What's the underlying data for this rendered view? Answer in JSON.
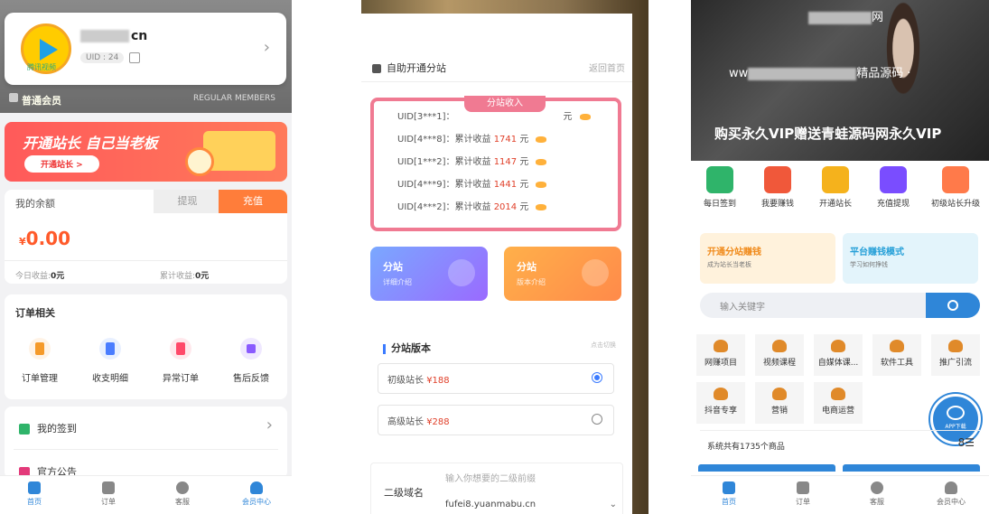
{
  "panel1": {
    "user": {
      "name_suffix": "cn",
      "uid": "UID : 24",
      "logo_text": "腾讯视频"
    },
    "member": {
      "level": "普通会员",
      "label_en": "REGULAR MEMBERS"
    },
    "banner": {
      "title": "开通站长 自己当老板",
      "button": "开通站长 >"
    },
    "balance": {
      "label": "我的余额",
      "tab_withdraw": "提现",
      "tab_recharge": "充值",
      "currency": "¥",
      "amount": "0.00",
      "today_label": "今日收益:",
      "today_value": "0元",
      "total_label": "累计收益:",
      "total_value": "0元"
    },
    "orders": {
      "title": "订单相关",
      "items": [
        "订单管理",
        "收支明细",
        "异常订单",
        "售后反馈"
      ]
    },
    "list": [
      "我的签到",
      "官方公告"
    ],
    "tabbar": [
      "首页",
      "订单",
      "客服",
      "会员中心"
    ]
  },
  "panel2": {
    "header": {
      "title": "自助开通分站",
      "back": "返回首页"
    },
    "income": {
      "title": "分站收入",
      "rows": [
        {
          "uid": "UID[3***1]：",
          "label": "",
          "value": "",
          "unit": "元"
        },
        {
          "uid": "UID[4***8]：",
          "label": "累计收益",
          "value": "1741",
          "unit": "元"
        },
        {
          "uid": "UID[1***2]：",
          "label": "累计收益",
          "value": "1147",
          "unit": "元"
        },
        {
          "uid": "UID[4***9]：",
          "label": "累计收益",
          "value": "1441",
          "unit": "元"
        },
        {
          "uid": "UID[4***2]：",
          "label": "累计收益",
          "value": "2014",
          "unit": "元"
        }
      ]
    },
    "cards": [
      {
        "title": "分站",
        "sub": "详细介绍",
        "color": "#8a7dff"
      },
      {
        "title": "分站",
        "sub": "版本介绍",
        "color": "#ff9a4a"
      }
    ],
    "version": {
      "title": "分站版本",
      "hint": "点击切换",
      "options": [
        {
          "label": "初级站长",
          "price": "¥188",
          "selected": true
        },
        {
          "label": "高级站长",
          "price": "¥288",
          "selected": false
        }
      ]
    },
    "domain": {
      "label": "二级域名",
      "placeholder": "输入你想要的二级前缀",
      "value": "fufei8.yuanmabu.cn"
    }
  },
  "panel3": {
    "hero": {
      "line1_suffix": "网",
      "line2_prefix": "ww",
      "line2_suffix": "精品源码 ·",
      "line3": "购买永久VIP赠送青蛙源码网永久VIP"
    },
    "icons": [
      {
        "label": "每日签到",
        "color": "#2fb46a"
      },
      {
        "label": "我要赚钱",
        "color": "#f0583a"
      },
      {
        "label": "开通站长",
        "color": "#f5b21c"
      },
      {
        "label": "充值提现",
        "color": "#7a4dff"
      },
      {
        "label": "初级站长升级",
        "color": "#ff7a4a"
      }
    ],
    "promos": [
      {
        "title": "开通分站赚钱",
        "sub": "成为站长当老板",
        "color": "#fff2dc",
        "accent": "#f08a1a"
      },
      {
        "title": "平台赚钱模式",
        "sub": "学习如何挣钱",
        "color": "#e3f4fb",
        "accent": "#27a0d8"
      }
    ],
    "search": {
      "placeholder": "输入关键字"
    },
    "categories": [
      "网赚项目",
      "视频课程",
      "自媒体课...",
      "软件工具",
      "推广引流",
      "抖音专享",
      "营销",
      "电商运营"
    ],
    "app_download": "APP下载",
    "total": {
      "text": "系统共有1735个商品",
      "grid": "8☰"
    },
    "tabbar": [
      "首页",
      "订单",
      "客服",
      "会员中心"
    ]
  }
}
